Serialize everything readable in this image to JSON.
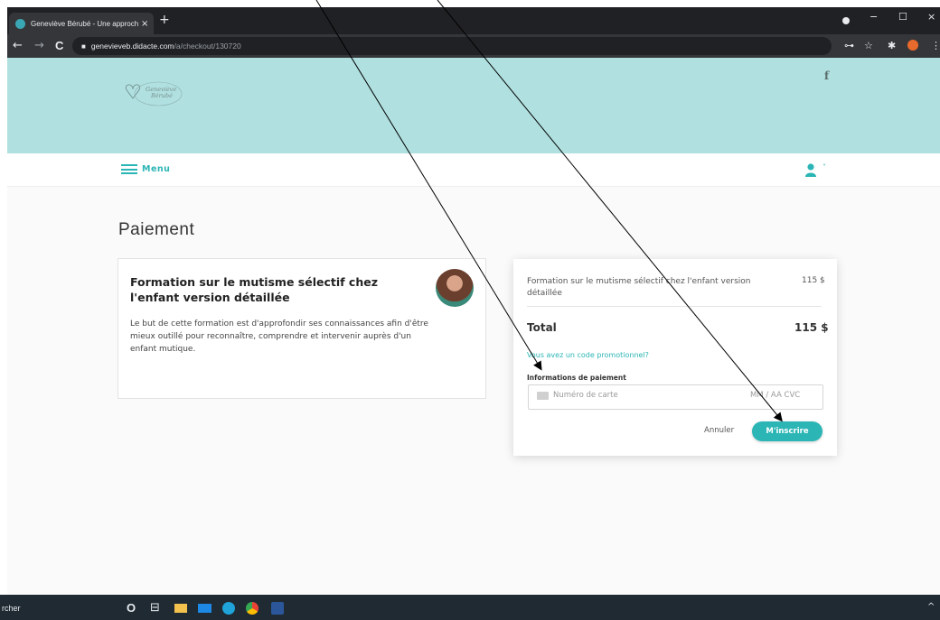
{
  "browser": {
    "tab_title": "Geneviève Bérubé - Une approch",
    "tab_close": "×",
    "new_tab": "+",
    "url_host": "genevieveb.didacte.com",
    "url_path": "/a/checkout/130720",
    "nav_back": "←",
    "nav_forward": "→",
    "nav_reload": "C",
    "win_minimize": "−",
    "win_maximize": "☐",
    "win_close": "×",
    "lock": "🔒",
    "key_icon": "⊶",
    "star_icon": "☆",
    "puzzle_icon": "✱",
    "menu_dots": "⋮"
  },
  "site": {
    "logo_text_1": "Geneviève",
    "logo_text_2": "Bérubé",
    "facebook_icon": "f",
    "menu_label": "Menu",
    "user_caret": "˅"
  },
  "page": {
    "title": "Paiement"
  },
  "course": {
    "title": "Formation sur le mutisme sélectif chez l'enfant version détaillée",
    "description": "Le but de cette formation est d'approfondir ses connaissances afin d'être mieux outillé pour reconnaître, comprendre et intervenir auprès d'un enfant mutique."
  },
  "order": {
    "item_name": "Formation sur le mutisme sélectif chez l'enfant version détaillée",
    "item_price": "115 $",
    "total_label": "Total",
    "total_price": "115 $",
    "promo_link": "Vous avez un code promotionnel?",
    "payment_label": "Informations de paiement",
    "card_placeholder": "Numéro de carte",
    "expiry_placeholder": "MM / AA  CVC",
    "cancel_label": "Annuler",
    "submit_label": "M'inscrire"
  },
  "taskbar": {
    "search_text": "rcher",
    "cortana": "O",
    "task_view": "⊟",
    "tray": "^"
  },
  "colors": {
    "accent": "#2bb5b5",
    "header_bg": "#b0e0e0",
    "browser_dark": "#202124",
    "taskbar": "#1f2a33"
  }
}
